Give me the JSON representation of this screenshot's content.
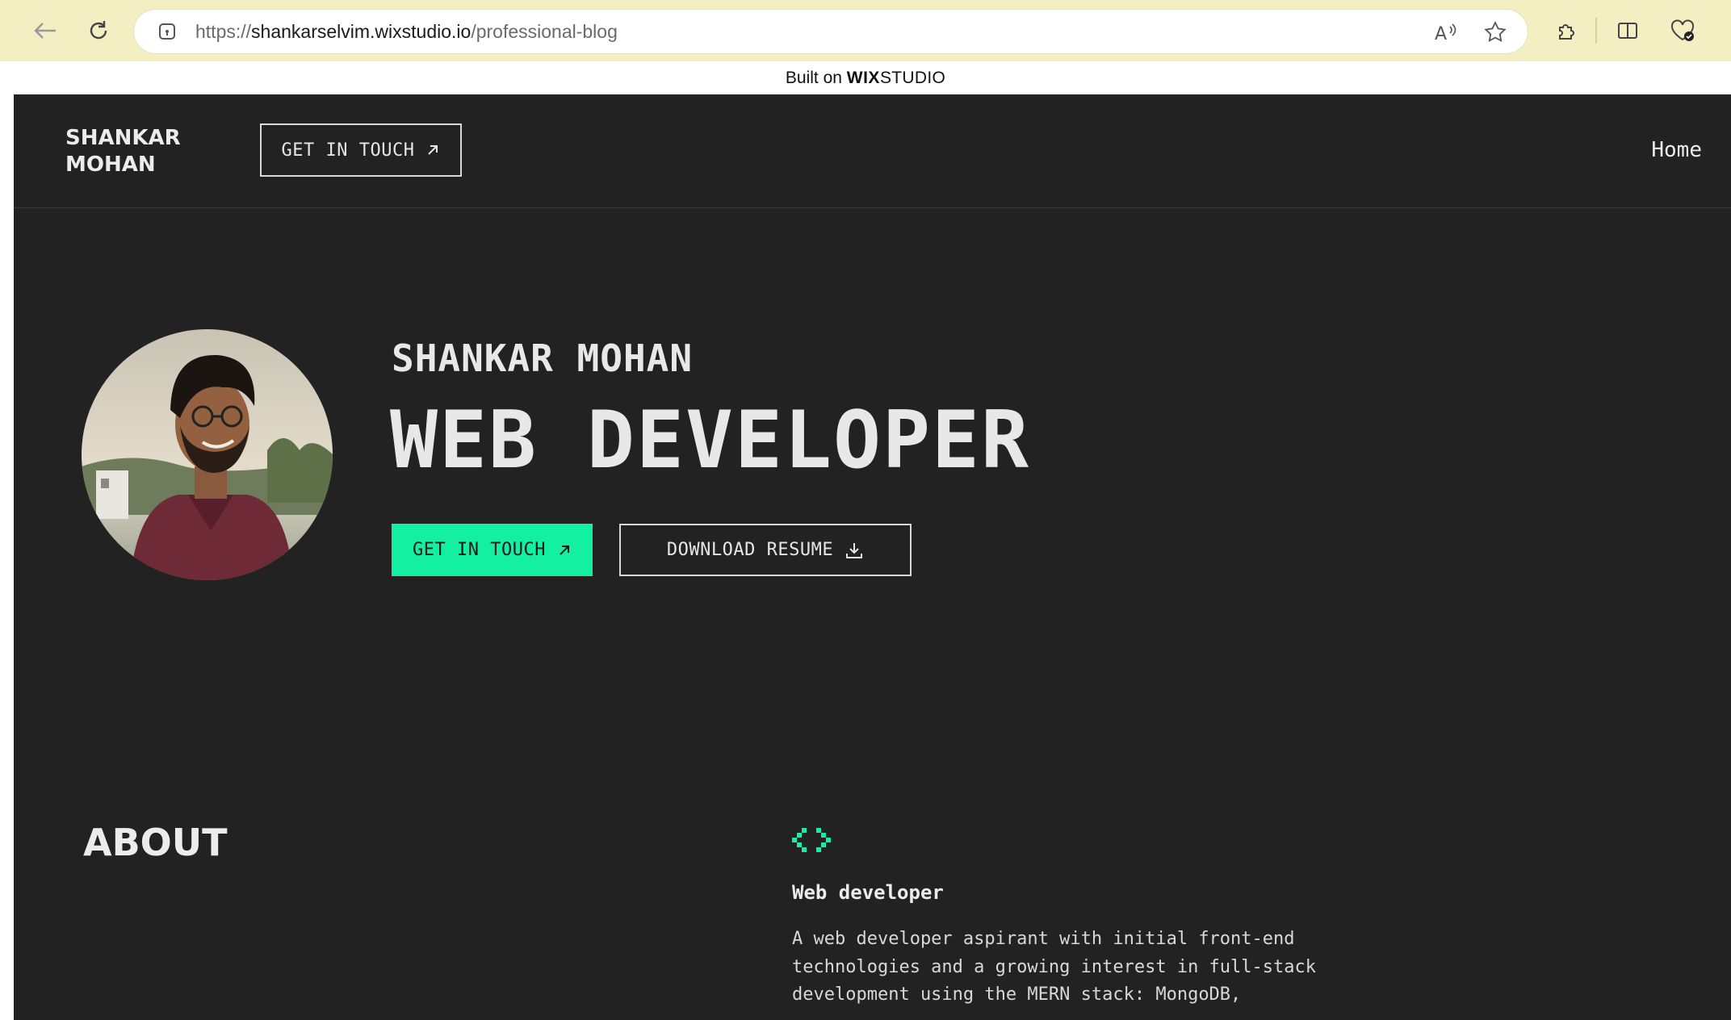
{
  "browser": {
    "url_prefix": "https://",
    "url_host": "shankarselvim.wixstudio.io",
    "url_path": "/professional-blog",
    "icons": [
      "back-icon",
      "reload-icon",
      "lock-icon",
      "read-aloud-icon",
      "favorite-star-icon",
      "extensions-icon",
      "split-screen-icon",
      "browser-essentials-icon"
    ]
  },
  "banner": {
    "prefix": "Built on",
    "brand_bold": "WIX",
    "brand_light": "STUDIO"
  },
  "header": {
    "logo": "SHANKAR MOHAN",
    "cta_label": "GET IN TOUCH",
    "nav_home": "Home"
  },
  "hero": {
    "name": "SHANKAR MOHAN",
    "title": "WEB DEVELOPER",
    "primary_cta": "GET IN TOUCH",
    "secondary_cta": "DOWNLOAD RESUME"
  },
  "about": {
    "heading": "ABOUT",
    "subheading": "Web developer",
    "body": "A web developer aspirant with initial front-end technologies and a growing interest in full-stack development using the MERN stack: MongoDB,"
  },
  "colors": {
    "site_bg": "#222222",
    "accent_green": "#13f0a4",
    "chrome_bg": "#f3efc2",
    "text_light": "#e8e8e8"
  }
}
